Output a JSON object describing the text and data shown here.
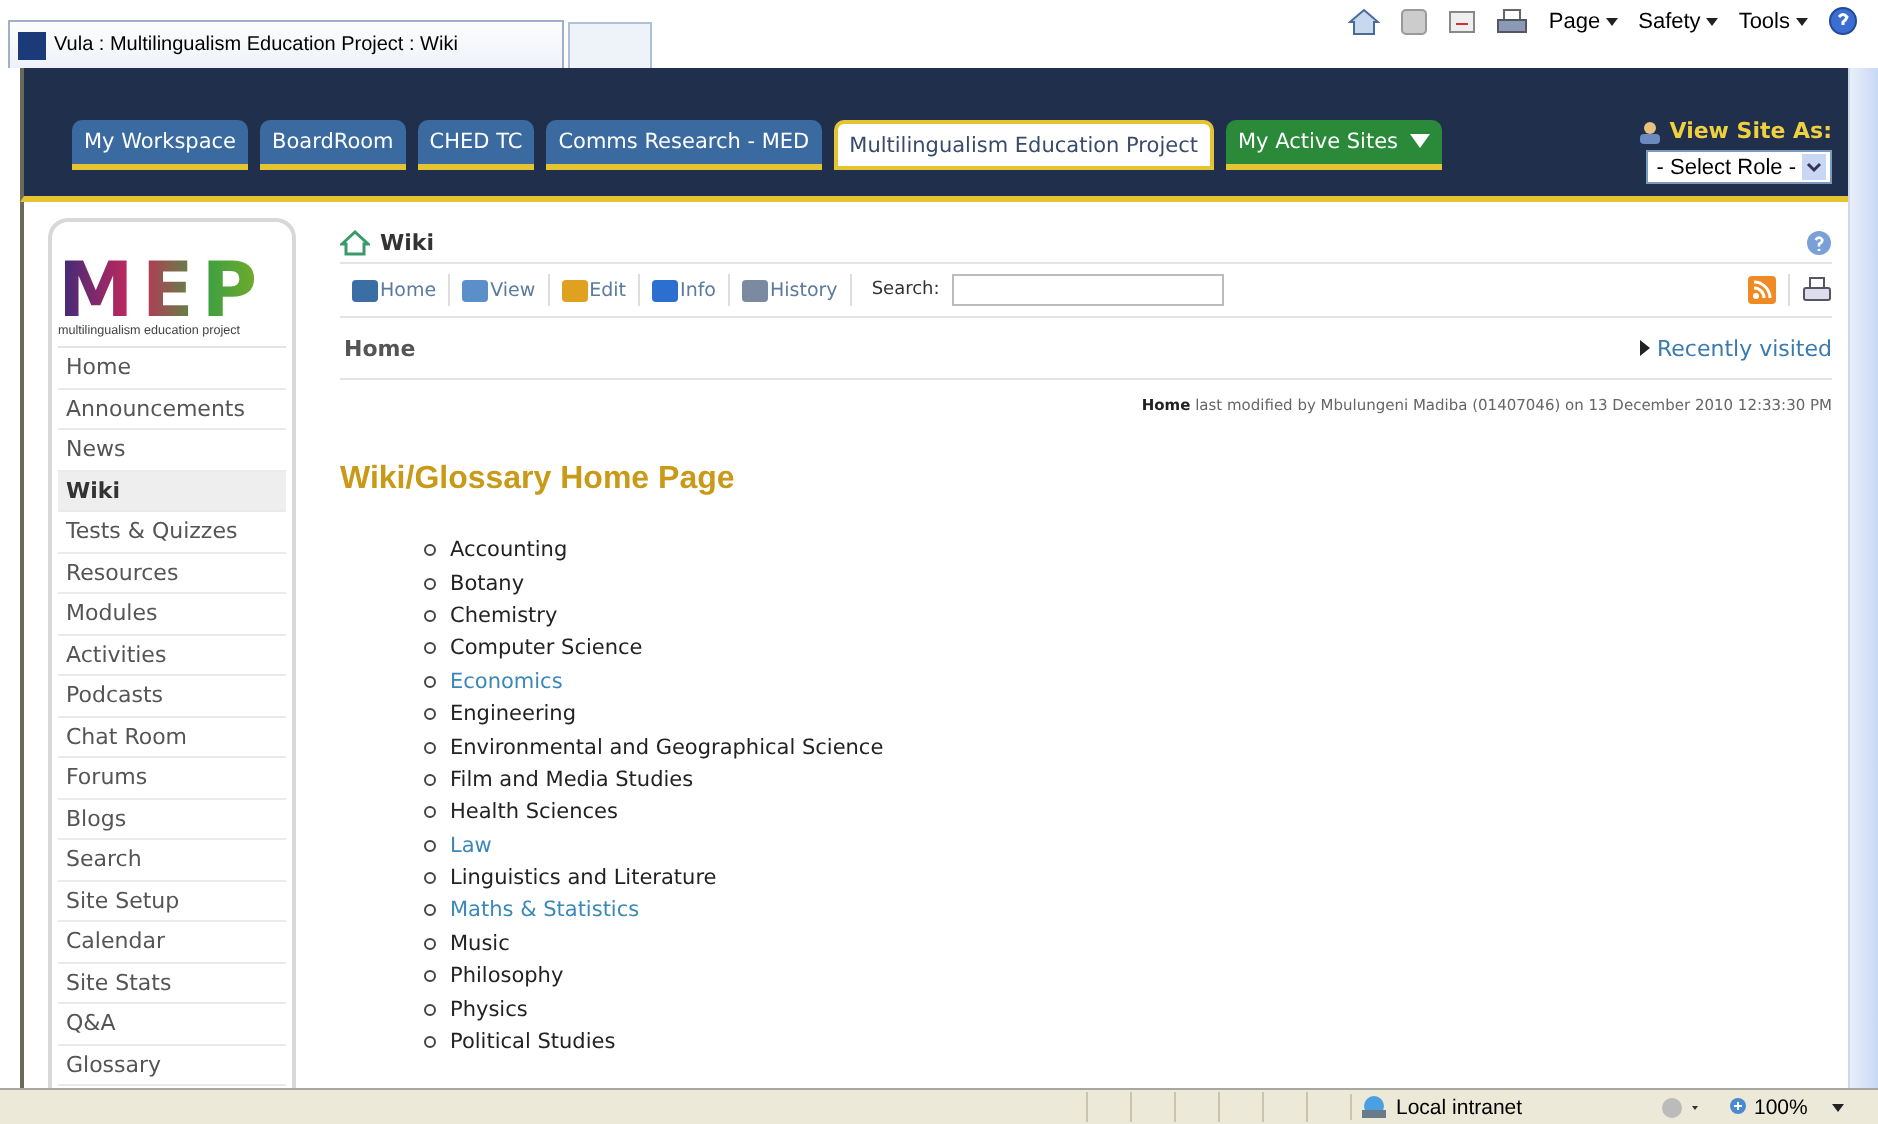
{
  "browser": {
    "tab_title": "Vula : Multilingualism Education Project : Wiki",
    "commands": [
      "Page",
      "Safety",
      "Tools"
    ]
  },
  "site_tabs": [
    {
      "label": "My Workspace",
      "selected": false,
      "kind": "site"
    },
    {
      "label": "BoardRoom",
      "selected": false,
      "kind": "site"
    },
    {
      "label": "CHED TC",
      "selected": false,
      "kind": "site"
    },
    {
      "label": "Comms Research - MED",
      "selected": false,
      "kind": "site"
    },
    {
      "label": "Multilingualism Education Project",
      "selected": true,
      "kind": "site"
    },
    {
      "label": "My Active Sites",
      "selected": false,
      "kind": "menu"
    }
  ],
  "view_as": {
    "label": "View Site As:",
    "select": "- Select Role -"
  },
  "logo": {
    "letters": "MEP",
    "caption": "multilingualism education project"
  },
  "sidebar": {
    "items": [
      {
        "label": "Home",
        "selected": false
      },
      {
        "label": "Announcements",
        "selected": false
      },
      {
        "label": "News",
        "selected": false
      },
      {
        "label": "Wiki",
        "selected": true
      },
      {
        "label": "Tests & Quizzes",
        "selected": false
      },
      {
        "label": "Resources",
        "selected": false
      },
      {
        "label": "Modules",
        "selected": false
      },
      {
        "label": "Activities",
        "selected": false
      },
      {
        "label": "Podcasts",
        "selected": false
      },
      {
        "label": "Chat Room",
        "selected": false
      },
      {
        "label": "Forums",
        "selected": false
      },
      {
        "label": "Blogs",
        "selected": false
      },
      {
        "label": "Search",
        "selected": false
      },
      {
        "label": "Site Setup",
        "selected": false
      },
      {
        "label": "Calendar",
        "selected": false
      },
      {
        "label": "Site Stats",
        "selected": false
      },
      {
        "label": "Q&A",
        "selected": false
      },
      {
        "label": "Glossary",
        "selected": false
      }
    ]
  },
  "tool": {
    "title": "Wiki",
    "toolbar": [
      "Home",
      "View",
      "Edit",
      "Info",
      "History"
    ],
    "search_label": "Search:",
    "breadcrumb": "Home",
    "recently_visited": "Recently visited",
    "modified": "**Home** last modified by Mbulungeni Madiba (01407046) on 13 December 2010 12:33:30 PM"
  },
  "page": {
    "heading": "Wiki/Glossary Home Page",
    "items": [
      {
        "label": "Accounting",
        "linked": false
      },
      {
        "label": "Botany",
        "linked": false
      },
      {
        "label": "Chemistry",
        "linked": false
      },
      {
        "label": "Computer Science",
        "linked": false
      },
      {
        "label": "Economics",
        "linked": true
      },
      {
        "label": "Engineering",
        "linked": false
      },
      {
        "label": "Environmental and Geographical Science",
        "linked": false
      },
      {
        "label": "Film and Media Studies",
        "linked": false
      },
      {
        "label": "Health Sciences",
        "linked": false
      },
      {
        "label": "Law",
        "linked": true
      },
      {
        "label": "Linguistics and Literature",
        "linked": false
      },
      {
        "label": "Maths & Statistics",
        "linked": true
      },
      {
        "label": "Music",
        "linked": false
      },
      {
        "label": "Philosophy",
        "linked": false
      },
      {
        "label": "Physics",
        "linked": false
      },
      {
        "label": "Political Studies",
        "linked": false
      }
    ]
  },
  "status_bar": {
    "zone": "Local intranet",
    "zoom": "100%"
  }
}
